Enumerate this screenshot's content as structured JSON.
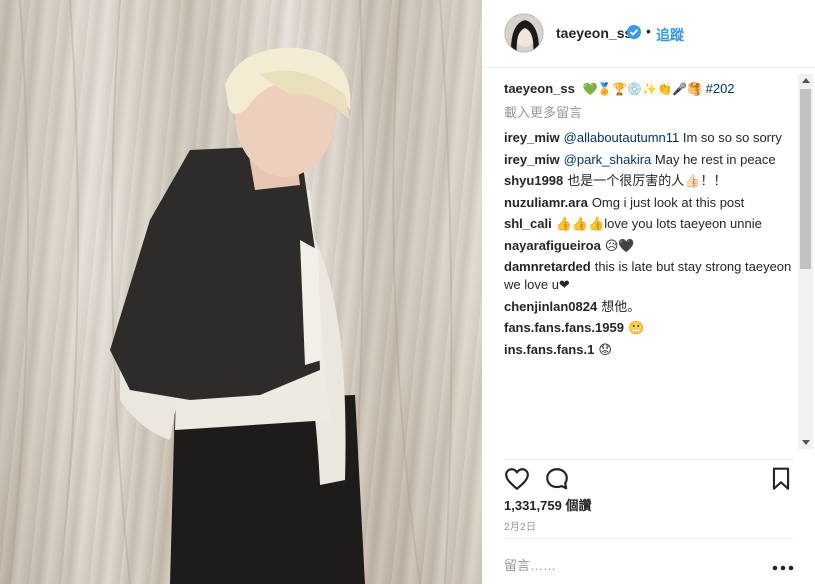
{
  "post": {
    "username": "taeyeon_ss",
    "follow_label": "追蹤",
    "dot": "•",
    "caption_user": "taeyeon_ss",
    "caption_emojis": "💚🏅🏆💿✨👏🎤🥞",
    "caption_hashtag": "#202",
    "load_more": "載入更多留言",
    "likes": "1,331,759 個讚",
    "date": "2月2日",
    "comment_placeholder": "留言……"
  },
  "comments": [
    {
      "user": "irey_miw",
      "mention": "@allaboutautumn11",
      "text": " Im so so so sorry"
    },
    {
      "user": "irey_miw",
      "mention": "@park_shakira",
      "text": " May he rest in peace"
    },
    {
      "user": "shyu1998",
      "mention": "",
      "text": "也是一个很厉害的人👍🏻！！"
    },
    {
      "user": "nuzuliamr.ara",
      "mention": "",
      "text": "Omg i just look at this post"
    },
    {
      "user": "shl_cali",
      "mention": "",
      "text": "👍👍👍love you lots taeyeon unnie"
    },
    {
      "user": "nayarafigueiroa",
      "mention": "",
      "text": "😥🖤"
    },
    {
      "user": "damnretarded",
      "mention": "",
      "text": "this is late but stay strong taeyeon we love u❤"
    },
    {
      "user": "chenjinlan0824",
      "mention": "",
      "text": "想他。"
    },
    {
      "user": "fans.fans.fans.1959",
      "mention": "",
      "text": "😬"
    },
    {
      "user": "ins.fans.fans.1",
      "mention": "",
      "text": "😟"
    }
  ],
  "colors": {
    "accent": "#3897f0",
    "link": "#003569",
    "muted": "#999999",
    "heart": "#e0245e"
  },
  "icons": {
    "like": "heart-outline-icon",
    "comment": "speech-bubble-icon",
    "save": "bookmark-icon",
    "more": "ellipsis-icon",
    "verified": "verified-badge-icon"
  }
}
